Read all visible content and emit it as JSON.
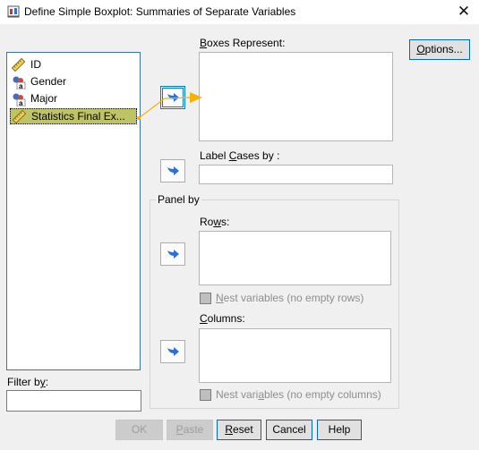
{
  "window": {
    "title": "Define Simple Boxplot: Summaries of Separate Variables",
    "close_glyph": "✕"
  },
  "variables": [
    {
      "label": "ID",
      "icon": "scale-ruler-icon",
      "selected": false
    },
    {
      "label": "Gender",
      "icon": "nominal-variable-icon",
      "selected": false
    },
    {
      "label": "Major",
      "icon": "nominal-variable-icon",
      "selected": false
    },
    {
      "label": "Statistics Final Ex...",
      "icon": "scale-ruler-icon",
      "selected": true
    }
  ],
  "boxes_represent": {
    "label_prefix": "",
    "mnemonic": "B",
    "label_rest": "oxes Represent:"
  },
  "label_cases": {
    "label_prefix": "Label ",
    "mnemonic": "C",
    "label_rest": "ases by :",
    "value": ""
  },
  "panel": {
    "title": "Panel by",
    "rows_label_prefix": "Ro",
    "rows_mnemonic": "w",
    "rows_label_rest": "s:",
    "nest_rows_prefix": "",
    "nest_rows_mnemonic": "N",
    "nest_rows_rest": "est variables (no empty rows)",
    "columns_label_prefix": "",
    "columns_mnemonic": "C",
    "columns_label_rest": "olumns:",
    "nest_cols_prefix": "Nest vari",
    "nest_cols_mnemonic": "a",
    "nest_cols_rest": "bles (no empty columns)"
  },
  "filter": {
    "label_prefix": "Filter b",
    "mnemonic": "y",
    "label_rest": ":",
    "value": ""
  },
  "buttons": {
    "options": {
      "prefix": "",
      "mnemonic": "O",
      "rest": "ptions..."
    },
    "ok": "OK",
    "paste": {
      "prefix": "",
      "mnemonic": "P",
      "rest": "aste"
    },
    "reset": {
      "prefix": "",
      "mnemonic": "R",
      "rest": "eset"
    },
    "cancel": "Cancel",
    "help": "Help"
  },
  "colors": {
    "accent": "#0067c0",
    "selection": "#bec464",
    "arrow": "#2a6fdb",
    "annotation": "#f5b300"
  }
}
